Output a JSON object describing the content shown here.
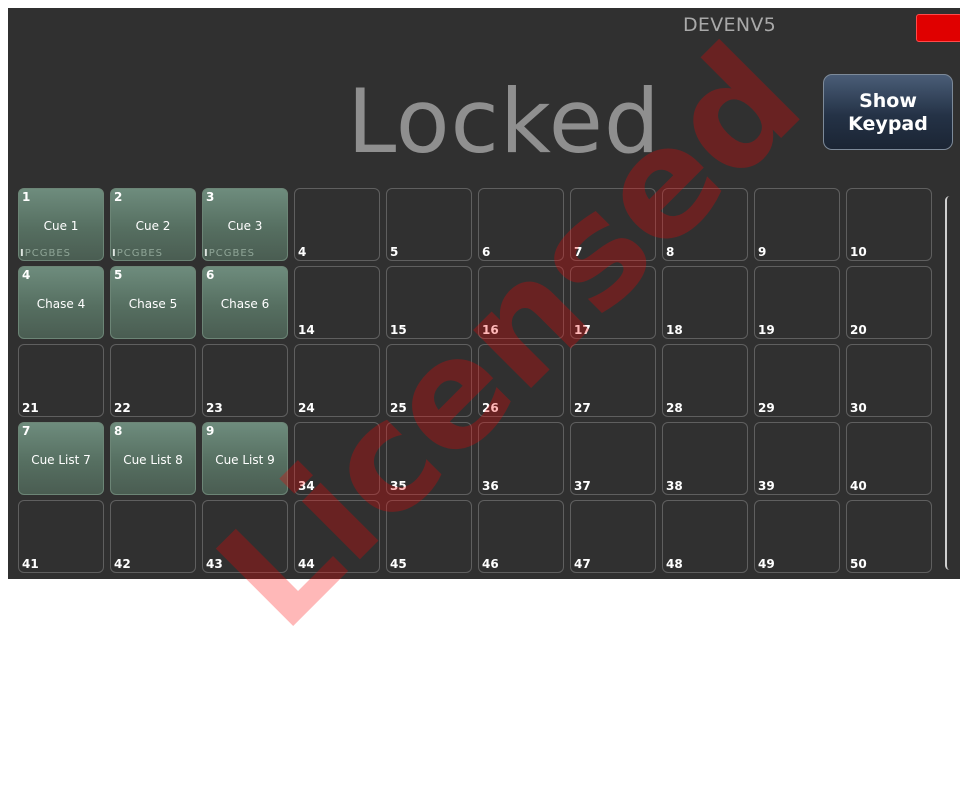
{
  "header": {
    "host_name": "DEVENV5",
    "locked_text": "Locked",
    "keypad_button_line1": "Show",
    "keypad_button_line2": "Keypad",
    "alarm_color": "#e00000"
  },
  "watermark_text": "Licensed",
  "playbacks": [
    {
      "slot": "1",
      "name": "Cue 1",
      "assigned": true,
      "flags": "IPCGBES"
    },
    {
      "slot": "2",
      "name": "Cue 2",
      "assigned": true,
      "flags": "IPCGBES"
    },
    {
      "slot": "3",
      "name": "Cue 3",
      "assigned": true,
      "flags": "IPCGBES"
    },
    {
      "slot": "4"
    },
    {
      "slot": "5"
    },
    {
      "slot": "6"
    },
    {
      "slot": "7"
    },
    {
      "slot": "8"
    },
    {
      "slot": "9"
    },
    {
      "slot": "10"
    },
    {
      "slot": "4",
      "name": "Chase 4",
      "assigned": true
    },
    {
      "slot": "5",
      "name": "Chase 5",
      "assigned": true
    },
    {
      "slot": "6",
      "name": "Chase 6",
      "assigned": true
    },
    {
      "slot": "14"
    },
    {
      "slot": "15"
    },
    {
      "slot": "16"
    },
    {
      "slot": "17"
    },
    {
      "slot": "18"
    },
    {
      "slot": "19"
    },
    {
      "slot": "20"
    },
    {
      "slot": "21"
    },
    {
      "slot": "22"
    },
    {
      "slot": "23"
    },
    {
      "slot": "24"
    },
    {
      "slot": "25"
    },
    {
      "slot": "26"
    },
    {
      "slot": "27"
    },
    {
      "slot": "28"
    },
    {
      "slot": "29"
    },
    {
      "slot": "30"
    },
    {
      "slot": "7",
      "name": "Cue List 7",
      "assigned": true
    },
    {
      "slot": "8",
      "name": "Cue List 8",
      "assigned": true
    },
    {
      "slot": "9",
      "name": "Cue List 9",
      "assigned": true
    },
    {
      "slot": "34"
    },
    {
      "slot": "35"
    },
    {
      "slot": "36"
    },
    {
      "slot": "37"
    },
    {
      "slot": "38"
    },
    {
      "slot": "39"
    },
    {
      "slot": "40"
    },
    {
      "slot": "41"
    },
    {
      "slot": "42"
    },
    {
      "slot": "43"
    },
    {
      "slot": "44"
    },
    {
      "slot": "45"
    },
    {
      "slot": "46"
    },
    {
      "slot": "47"
    },
    {
      "slot": "48"
    },
    {
      "slot": "49"
    },
    {
      "slot": "50"
    }
  ]
}
